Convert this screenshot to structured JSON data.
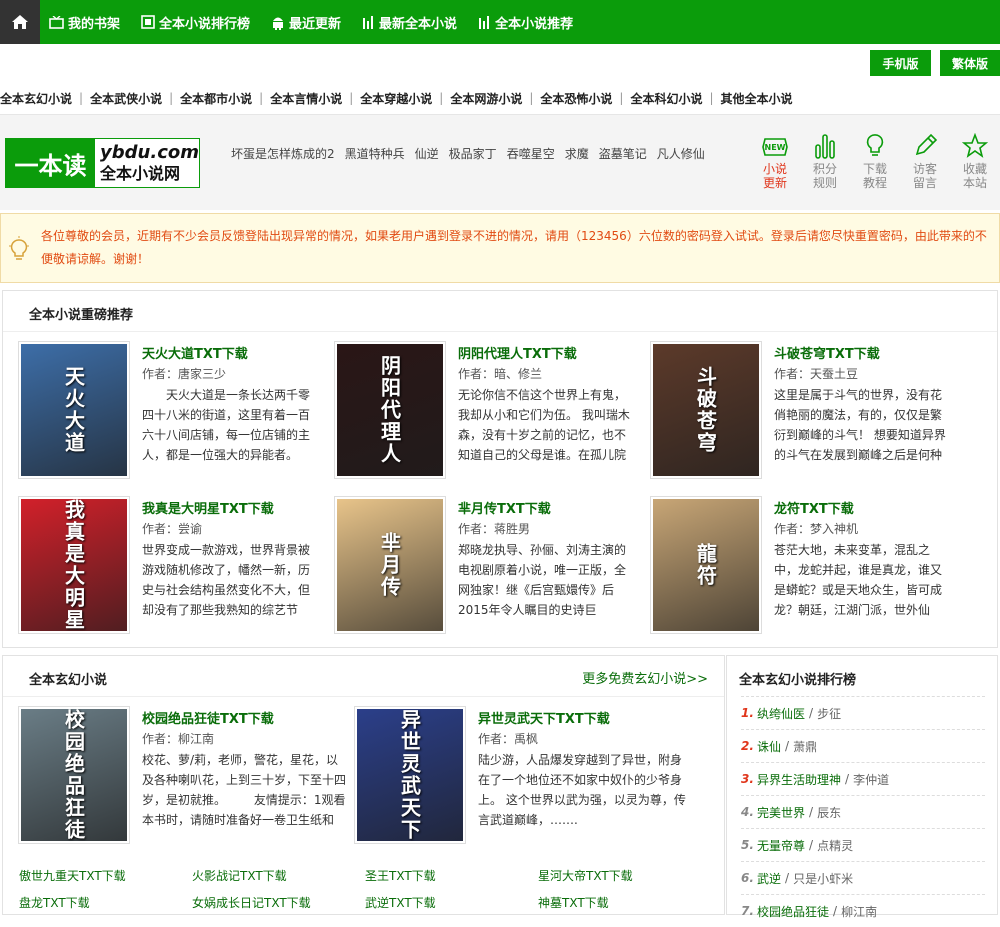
{
  "nav": {
    "items": [
      {
        "label": "我的书架",
        "icon": "tv-icon"
      },
      {
        "label": "全本小说排行榜",
        "icon": "film-icon"
      },
      {
        "label": "最近更新",
        "icon": "android-icon"
      },
      {
        "label": "最新全本小说",
        "icon": "bars-icon"
      },
      {
        "label": "全本小说推荐",
        "icon": "bars-icon"
      }
    ]
  },
  "top_buttons": {
    "mobile": "手机版",
    "traditional": "繁体版"
  },
  "categories": [
    "全本玄幻小说",
    "全本武侠小说",
    "全本都市小说",
    "全本言情小说",
    "全本穿越小说",
    "全本网游小说",
    "全本恐怖小说",
    "全本科幻小说",
    "其他全本小说"
  ],
  "logo": {
    "left": "一本读",
    "domain": "ybdu.com",
    "tagline": "全本小说网"
  },
  "hot_links": [
    "坏蛋是怎样炼成的2",
    "黑道特种兵",
    "仙逆",
    "极品家丁",
    "吞噬星空",
    "求魔",
    "盗墓笔记",
    "凡人修仙"
  ],
  "quick_links": [
    {
      "line1": "小说",
      "line2": "更新",
      "icon": "new-badge-icon"
    },
    {
      "line1": "积分",
      "line2": "规则",
      "icon": "bar-chart-icon"
    },
    {
      "line1": "下载",
      "line2": "教程",
      "icon": "lightbulb-icon"
    },
    {
      "line1": "访客",
      "line2": "留言",
      "icon": "pencil-icon"
    },
    {
      "line1": "收藏",
      "line2": "本站",
      "icon": "star-icon"
    }
  ],
  "notice": "各位尊敬的会员，近期有不少会员反馈登陆出现异常的情况，如果老用户遇到登录不进的情况，请用（123456）六位数的密码登入试试。登录后请您尽快重置密码，由此带来的不便敬请谅解。谢谢！",
  "recommend": {
    "title": "全本小说重磅推荐",
    "books": [
      {
        "title": "天火大道TXT下载",
        "author": "作者：唐家三少",
        "desc": "　　天火大道是一条长达两千零四十八米的街道，这里有着一百六十八间店铺，每一位店铺的主人，都是一位强大的异能者。 绎……."
      },
      {
        "title": "阴阳代理人TXT下载",
        "author": "作者：暗、修兰",
        "desc": "无论你信不信这个世界上有鬼，我却从小和它们为伍。 我叫瑞木森，没有十岁之前的记忆，也不知道自己的父母是谁。在孤儿院里长"
      },
      {
        "title": "斗破苍穹TXT下载",
        "author": "作者：天蚕土豆",
        "desc": "这里是属于斗气的世界，没有花俏艳丽的魔法，有的，仅仅是繁衍到巅峰的斗气！ 想要知道异界的斗气在发展到巅峰之后是何种境……."
      },
      {
        "title": "我真是大明星TXT下载",
        "author": "作者：尝谕",
        "desc": "世界变成一款游戏，世界背景被游戏随机修改了，幡然一新，历史与社会结构虽然变化不大，但却没有了那些我熟知的综艺节目、音乐"
      },
      {
        "title": "芈月传TXT下载",
        "author": "作者：蒋胜男",
        "desc": "郑晓龙执导、孙俪、刘涛主演的电视剧原着小说，唯一正版，全网独家！继《后宫甄嬛传》后2015年令人瞩目的史诗巨献！“女性大历"
      },
      {
        "title": "龙符TXT下载",
        "author": "作者：梦入神机",
        "desc": "苍茫大地，未来变革，混乱之中，龙蛇并起，谁是真龙，谁又是蟒蛇？或是天地众生，皆可成龙？朝廷，江湖门派，世外仙道，千年世"
      }
    ]
  },
  "xuanhuan": {
    "title": "全本玄幻小说",
    "more": "更多免费玄幻小说>>",
    "books": [
      {
        "title": "校园绝品狂徒TXT下载",
        "author": "作者：柳江南",
        "desc": "校花、萝/莉，老师，警花，星花，以及各种喇叭花，上到三十岁，下至十四岁，是初就推。 　　友情提示：1观看本书时，请随时准备好一卷卫生纸和"
      },
      {
        "title": "异世灵武天下TXT下载",
        "author": "作者：禹枫",
        "desc": "陆少游，人品爆发穿越到了异世，附身在了一个地位还不如家中奴仆的少爷身上。 这个世界以武为强，以灵为尊，传言武道巅峰，……."
      }
    ],
    "links": [
      "傲世九重天TXT下载",
      "火影战记TXT下载",
      "圣王TXT下载",
      "星河大帝TXT下载",
      "盘龙TXT下载",
      "女娲成长日记TXT下载",
      "武逆TXT下载",
      "神墓TXT下载"
    ]
  },
  "ranking": {
    "title": "全本玄幻小说排行榜",
    "items": [
      {
        "num": "1.",
        "title": "纨绔仙医",
        "author": "步征"
      },
      {
        "num": "2.",
        "title": "诛仙",
        "author": "萧鼎"
      },
      {
        "num": "3.",
        "title": "异界生活助理神",
        "author": "李仲道"
      },
      {
        "num": "4.",
        "title": "完美世界",
        "author": "辰东"
      },
      {
        "num": "5.",
        "title": "无量帝尊",
        "author": "点精灵"
      },
      {
        "num": "6.",
        "title": "武逆",
        "author": "只是小虾米"
      },
      {
        "num": "7.",
        "title": "校园绝品狂徒",
        "author": "柳江南"
      }
    ]
  },
  "covers": [
    {
      "text": "天火大道",
      "bg": "#3d6ea8"
    },
    {
      "text": "阴阳代理人",
      "bg": "#2a1616"
    },
    {
      "text": "斗破苍穹",
      "bg": "#5c3a2a"
    },
    {
      "text": "我真是大明星",
      "bg": "#d2202a"
    },
    {
      "text": "芈月传",
      "bg": "#e8c48a"
    },
    {
      "text": "龍符",
      "bg": "#c8a676"
    },
    {
      "text": "校园绝品狂徒",
      "bg": "#6a7d86"
    },
    {
      "text": "异世灵武天下",
      "bg": "#2b3f8a"
    }
  ],
  "colors": {
    "brand_green": "#0b9c0b",
    "link_green": "#0a6d0a",
    "notice_red": "#e14b12",
    "rank_red": "#e0361c"
  }
}
